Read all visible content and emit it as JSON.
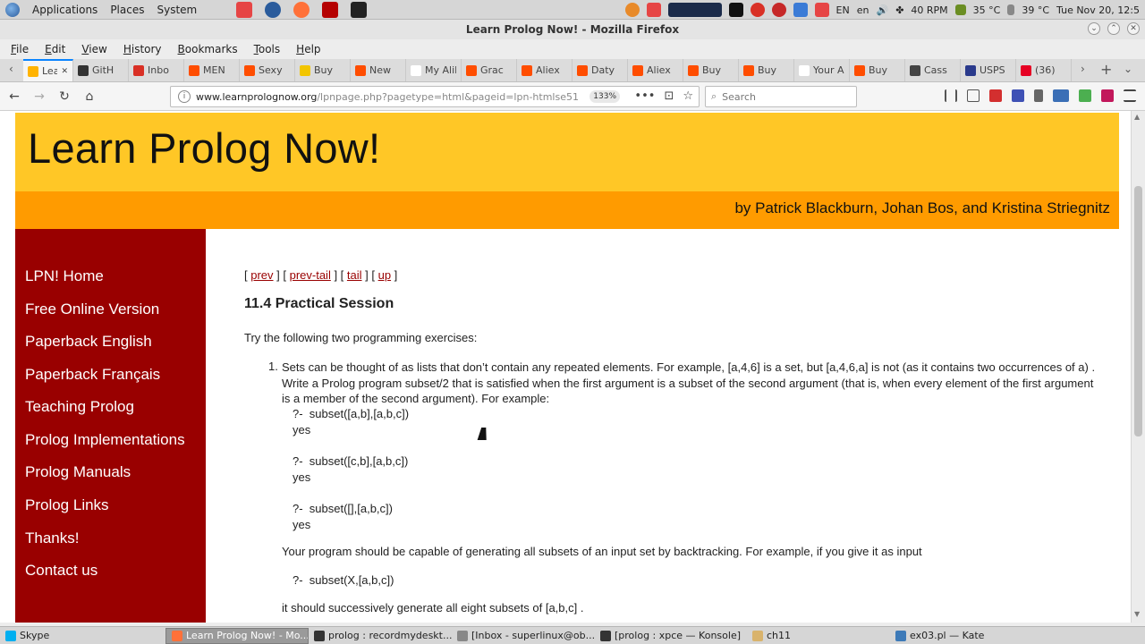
{
  "os_panel": {
    "menus": [
      "Applications",
      "Places",
      "System"
    ],
    "tray_rpm": "40 RPM",
    "tray_temp1": "35 °C",
    "tray_temp2": "39 °C",
    "tray_lang1": "EN",
    "tray_lang2": "en",
    "clock": "Tue Nov 20, 12:5"
  },
  "window": {
    "title": "Learn Prolog Now! - Mozilla Firefox"
  },
  "menubar": [
    "File",
    "Edit",
    "View",
    "History",
    "Bookmarks",
    "Tools",
    "Help"
  ],
  "tabs": [
    {
      "label": "Learn",
      "color": "#ffb300",
      "active": true
    },
    {
      "label": "GitH",
      "color": "#333333"
    },
    {
      "label": "Inbo",
      "color": "#d93025"
    },
    {
      "label": "MEN",
      "color": "#ff4d00"
    },
    {
      "label": "Sexy",
      "color": "#ff4d00"
    },
    {
      "label": "Buy",
      "color": "#f2c500"
    },
    {
      "label": "New",
      "color": "#ff4d00"
    },
    {
      "label": "My AliEx",
      "color": "#ffffff"
    },
    {
      "label": "Grac",
      "color": "#ff4d00"
    },
    {
      "label": "Aliex",
      "color": "#ff4d00"
    },
    {
      "label": "Daty",
      "color": "#ff4d00"
    },
    {
      "label": "Aliex",
      "color": "#ff4d00"
    },
    {
      "label": "Buy",
      "color": "#ff4d00"
    },
    {
      "label": "Buy",
      "color": "#ff4d00"
    },
    {
      "label": "Your AliE",
      "color": "#ffffff"
    },
    {
      "label": "Buy",
      "color": "#ff4d00"
    },
    {
      "label": "Cass",
      "color": "#444444"
    },
    {
      "label": "USPS",
      "color": "#2a3a8c"
    },
    {
      "label": "(36)",
      "color": "#e60023"
    }
  ],
  "navbar": {
    "url_host": "www.learnprolognow.org",
    "url_path": "/lpnpage.php?pagetype=html&pageid=lpn-htmlse51",
    "zoom": "133%",
    "search_placeholder": "Search"
  },
  "page": {
    "title": "Learn Prolog Now!",
    "byline": "by Patrick Blackburn, Johan Bos, and Kristina Striegnitz",
    "sidebar": [
      "LPN! Home",
      "Free Online Version",
      "Paperback English",
      "Paperback Français",
      "Teaching Prolog",
      "Prolog Implementations",
      "Prolog Manuals",
      "Prolog Links",
      "Thanks!",
      "Contact us"
    ],
    "navlinks": [
      "prev",
      "prev-tail",
      "tail",
      "up"
    ],
    "heading": "11.4 Practical Session",
    "intro": "Try the following two programming exercises:",
    "exercise_number": "1.",
    "exercise_text": "Sets can be thought of as lists that don’t contain any repeated elements. For example, [a,4,6] is a set, but [a,4,6,a] is not (as it contains two occurrences of a) . Write a Prolog program subset/2 that is satisfied when the first argument is a subset of the second argument (that is, when every element of the first argument is a member of the second argument). For example:",
    "code1": "?-  subset([a,b],[a,b,c])",
    "yes1": "yes",
    "code2": "?-  subset([c,b],[a,b,c])",
    "yes2": "yes",
    "code3": "?-  subset([],[a,b,c])",
    "yes3": "yes",
    "para2": "Your program should be capable of generating all subsets of an input set by backtracking. For example, if you give it as input",
    "code4": "?-  subset(X,[a,b,c])",
    "para3": "it should successively generate all eight subsets of [a,b,c] ."
  },
  "taskbar": [
    {
      "label": "Skype",
      "color": "#00aff0"
    },
    {
      "label": "Learn Prolog Now! - Mo...",
      "color": "#ff7139",
      "active": true
    },
    {
      "label": "prolog : recordmydeskt...",
      "color": "#333333"
    },
    {
      "label": "[Inbox - superlinux@ob...",
      "color": "#888888"
    },
    {
      "label": "[prolog : xpce — Konsole]",
      "color": "#333333"
    },
    {
      "label": "ch11",
      "color": "#d9b36c"
    },
    {
      "label": "ex03.pl — Kate",
      "color": "#3d7ab8"
    }
  ]
}
